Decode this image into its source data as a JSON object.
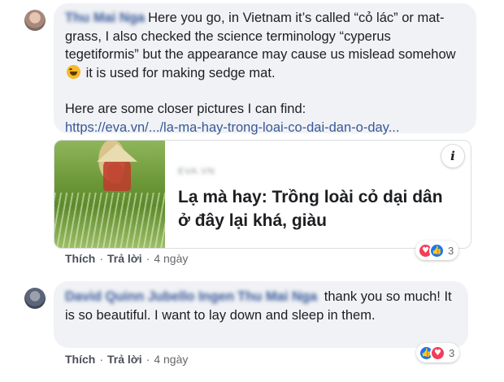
{
  "comments": [
    {
      "author": "Thu Mai Nga",
      "text_line1": "Here you go, in Vietnam it’s called “cỏ lác” or mat-grass, I also checked the science terminology “cyperus tegetiformis” but the appearance may cause us mislead somehow",
      "text_line1_tail": " it is used for making sedge mat.",
      "text_line2": "Here are some closer pictures I can find:",
      "link_text": "https://eva.vn/.../la-ma-hay-trong-loai-co-dai-dan-o-day...",
      "link_card": {
        "source": "EVA.VN",
        "title": "Lạ mà hay: Trồng loài cỏ dại dân ở đây lại khá, giàu",
        "info_label": "i"
      },
      "actions": {
        "like": "Thích",
        "reply": "Trả lời",
        "separator": "·",
        "time": "4 ngày"
      },
      "reactions": {
        "icons": [
          "love-icon",
          "like-icon"
        ],
        "count": "3"
      }
    },
    {
      "author": "David Quinn Jubello Ingen",
      "mention": "Thu Mai Nga",
      "text": " thank you so much! It is so beautiful. I want to lay down and sleep in them.",
      "actions": {
        "like": "Thích",
        "reply": "Trả lời",
        "separator": "·",
        "time": "4 ngày"
      },
      "reactions": {
        "icons": [
          "like-icon",
          "love-icon"
        ],
        "count": "3"
      }
    }
  ],
  "colors": {
    "bubble": "#f0f2f5",
    "link": "#385898",
    "love": "#f33e58",
    "like": "#1877f2"
  }
}
